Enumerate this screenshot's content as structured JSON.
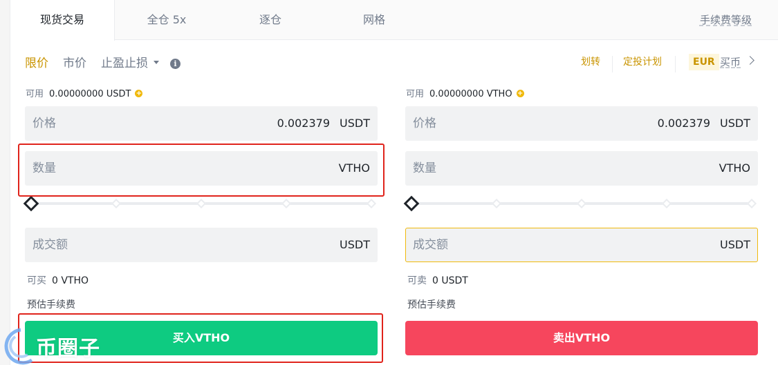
{
  "tabs": {
    "items": [
      "现货交易",
      "全仓 5x",
      "逐仓",
      "网格"
    ],
    "fee_level": "手续费等级"
  },
  "order_types": {
    "limit": "限价",
    "market": "市价",
    "stop": "止盈止损"
  },
  "links": {
    "transfer": "划转",
    "auto_invest": "定投计划",
    "currency": "EUR",
    "buy_coin": "买币"
  },
  "buy": {
    "available_label": "可用",
    "available_value": "0.00000000 USDT",
    "price_label": "价格",
    "price_value": "0.002379",
    "price_unit": "USDT",
    "amount_label": "数量",
    "amount_unit": "VTHO",
    "total_label": "成交额",
    "total_unit": "USDT",
    "max_label": "可买",
    "max_value": "0 VTHO",
    "fee_label": "预估手续费",
    "button": "买入VTHO"
  },
  "sell": {
    "available_label": "可用",
    "available_value": "0.00000000 VTHO",
    "price_label": "价格",
    "price_value": "0.002379",
    "price_unit": "USDT",
    "amount_label": "数量",
    "amount_unit": "VTHO",
    "total_label": "成交额",
    "total_unit": "USDT",
    "max_label": "可卖",
    "max_value": "0 USDT",
    "fee_label": "预估手续费",
    "button": "卖出VTHO"
  },
  "slider_level": {
    "buy": 0,
    "sell": 0
  },
  "watermark": "币圈子",
  "colors": {
    "accent": "#c99400",
    "buy": "#0ecb81",
    "sell": "#f6465d",
    "highlight": "#e0231b"
  }
}
